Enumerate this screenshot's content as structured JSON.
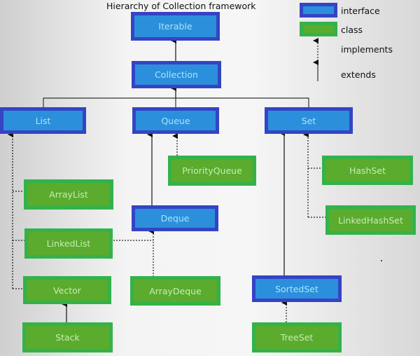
{
  "title": "Hierarchy of Collection framework",
  "legend": {
    "interface": "interface",
    "class": "class",
    "implements": "implements",
    "extends": "extends"
  },
  "colors": {
    "interface_fill": "#2c8fdc",
    "interface_border": "#3444c4",
    "interface_text": "#a7e6f5",
    "class_fill": "#5aab2e",
    "class_border": "#34b24a",
    "class_text": "#c9edb0"
  },
  "nodes": {
    "iterable": {
      "label": "Iterable",
      "kind": "interface"
    },
    "collection": {
      "label": "Collection",
      "kind": "interface"
    },
    "list": {
      "label": "List",
      "kind": "interface"
    },
    "queue": {
      "label": "Queue",
      "kind": "interface"
    },
    "set": {
      "label": "Set",
      "kind": "interface"
    },
    "priorityqueue": {
      "label": "PriorityQueue",
      "kind": "class"
    },
    "hashset": {
      "label": "HashSet",
      "kind": "class"
    },
    "arraylist": {
      "label": "ArrayList",
      "kind": "class"
    },
    "linkedlist": {
      "label": "LinkedList",
      "kind": "class"
    },
    "deque": {
      "label": "Deque",
      "kind": "interface"
    },
    "linkedhashset": {
      "label": "LinkedHashSet",
      "kind": "class"
    },
    "vector": {
      "label": "Vector",
      "kind": "class"
    },
    "arraydeque": {
      "label": "ArrayDeque",
      "kind": "class"
    },
    "sortedset": {
      "label": "SortedSet",
      "kind": "interface"
    },
    "stack": {
      "label": "Stack",
      "kind": "class"
    },
    "treeset": {
      "label": "TreeSet",
      "kind": "class"
    }
  },
  "relations": [
    {
      "from": "collection",
      "to": "iterable",
      "type": "extends"
    },
    {
      "from": "list",
      "to": "collection",
      "type": "extends"
    },
    {
      "from": "queue",
      "to": "collection",
      "type": "extends"
    },
    {
      "from": "set",
      "to": "collection",
      "type": "extends"
    },
    {
      "from": "arraylist",
      "to": "list",
      "type": "implements"
    },
    {
      "from": "linkedlist",
      "to": "list",
      "type": "implements"
    },
    {
      "from": "vector",
      "to": "list",
      "type": "implements"
    },
    {
      "from": "stack",
      "to": "vector",
      "type": "extends"
    },
    {
      "from": "priorityqueue",
      "to": "queue",
      "type": "implements"
    },
    {
      "from": "deque",
      "to": "queue",
      "type": "extends"
    },
    {
      "from": "linkedlist",
      "to": "deque",
      "type": "implements"
    },
    {
      "from": "arraydeque",
      "to": "deque",
      "type": "implements"
    },
    {
      "from": "hashset",
      "to": "set",
      "type": "implements"
    },
    {
      "from": "linkedhashset",
      "to": "set",
      "type": "implements"
    },
    {
      "from": "sortedset",
      "to": "set",
      "type": "extends"
    },
    {
      "from": "treeset",
      "to": "sortedset",
      "type": "implements"
    }
  ]
}
